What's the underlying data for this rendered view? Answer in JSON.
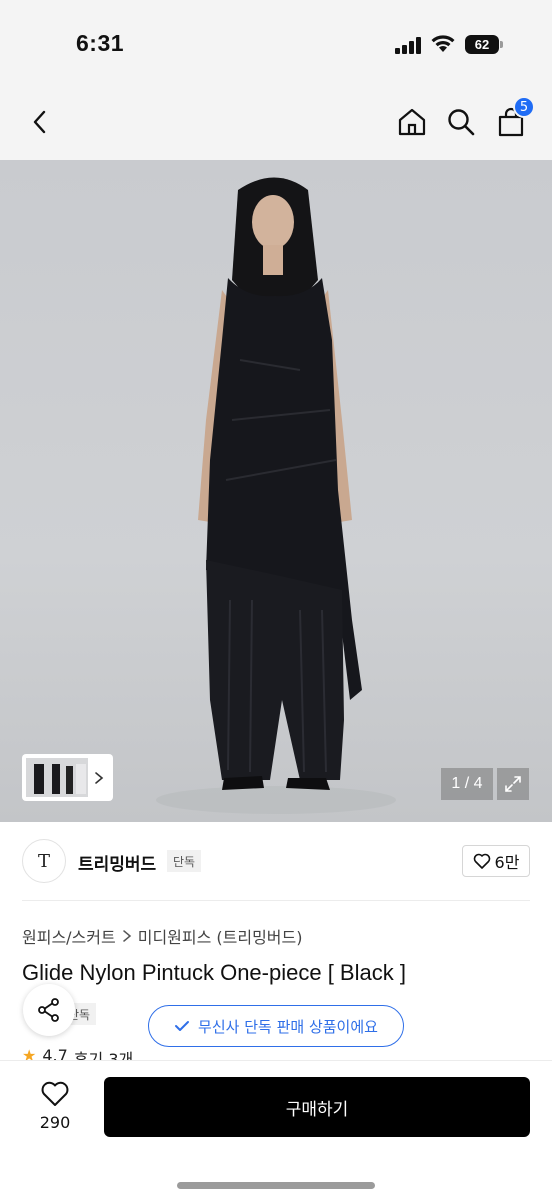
{
  "status_bar": {
    "time": "6:31",
    "battery": "62"
  },
  "nav": {
    "cart_count": "5"
  },
  "gallery": {
    "page_indicator": "1 / 4"
  },
  "brand": {
    "name": "트리밍버드",
    "logo_text": "T",
    "exclusive_tag": "단독",
    "like_count": "6만"
  },
  "breadcrumb": {
    "category": "원피스/스커트",
    "subcategory": "미디원피스 (트리밍버드)"
  },
  "product": {
    "title": "Glide Nylon Pintuck One-piece [ Black ]",
    "sub_tag": "단독"
  },
  "promo": {
    "text": "무신사 단독 판매 상품이에요"
  },
  "rating": {
    "score": "4.7",
    "reviews": "후기 3개"
  },
  "bottom_bar": {
    "wish_count": "290",
    "buy_label": "구매하기"
  },
  "colors": {
    "accent_blue": "#2f6fe8",
    "badge_blue": "#1f6cf5",
    "buy_button": "#000000",
    "star": "#f5a623"
  }
}
